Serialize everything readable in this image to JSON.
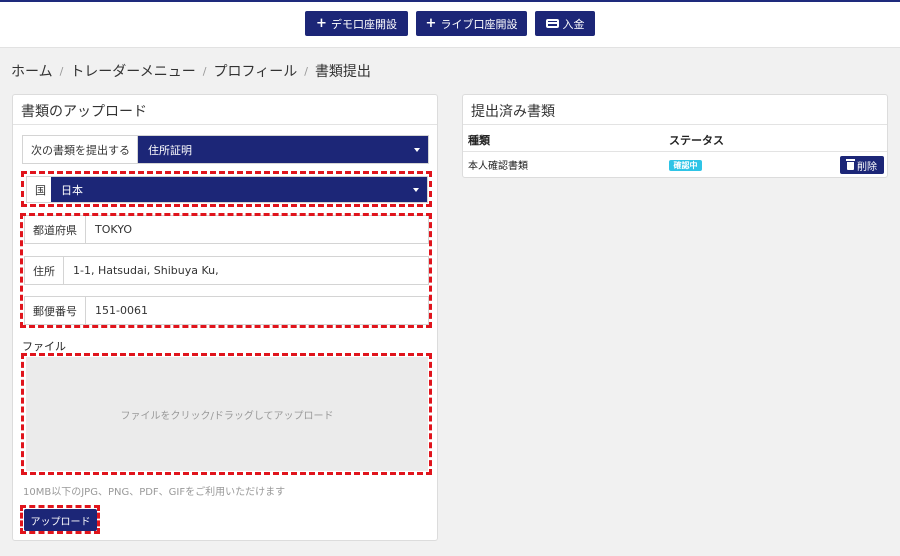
{
  "topbar": {
    "demo_account_label": "デモ口座開設",
    "live_account_label": "ライブ口座開設",
    "deposit_label": "入金"
  },
  "breadcrumb": [
    "ホーム",
    "トレーダーメニュー",
    "プロフィール",
    "書類提出"
  ],
  "upload_panel": {
    "title": "書類のアップロード",
    "doc_type_label": "次の書類を提出する",
    "doc_type_value": "住所証明",
    "country_label": "国",
    "country_value": "日本",
    "prefecture_label": "都道府県",
    "prefecture_value": "TOKYO",
    "address_label": "住所",
    "address_value": "1-1, Hatsudai, Shibuya Ku,",
    "postal_label": "郵便番号",
    "postal_value": "151-0061",
    "file_label": "ファイル",
    "dropzone_text": "ファイルをクリック/ドラッグしてアップロード",
    "hint": "10MB以下のJPG、PNG、PDF、GIFをご利用いただけます",
    "upload_button": "アップロード"
  },
  "submitted_panel": {
    "title": "提出済み書類",
    "columns": [
      "種類",
      "ステータス"
    ],
    "rows": [
      {
        "type": "本人確認書類",
        "status": "確認中",
        "action": "削除"
      }
    ]
  },
  "colors": {
    "navy": "#1c2677",
    "status_badge": "#2ec4e6",
    "highlight": "#e0141c"
  }
}
